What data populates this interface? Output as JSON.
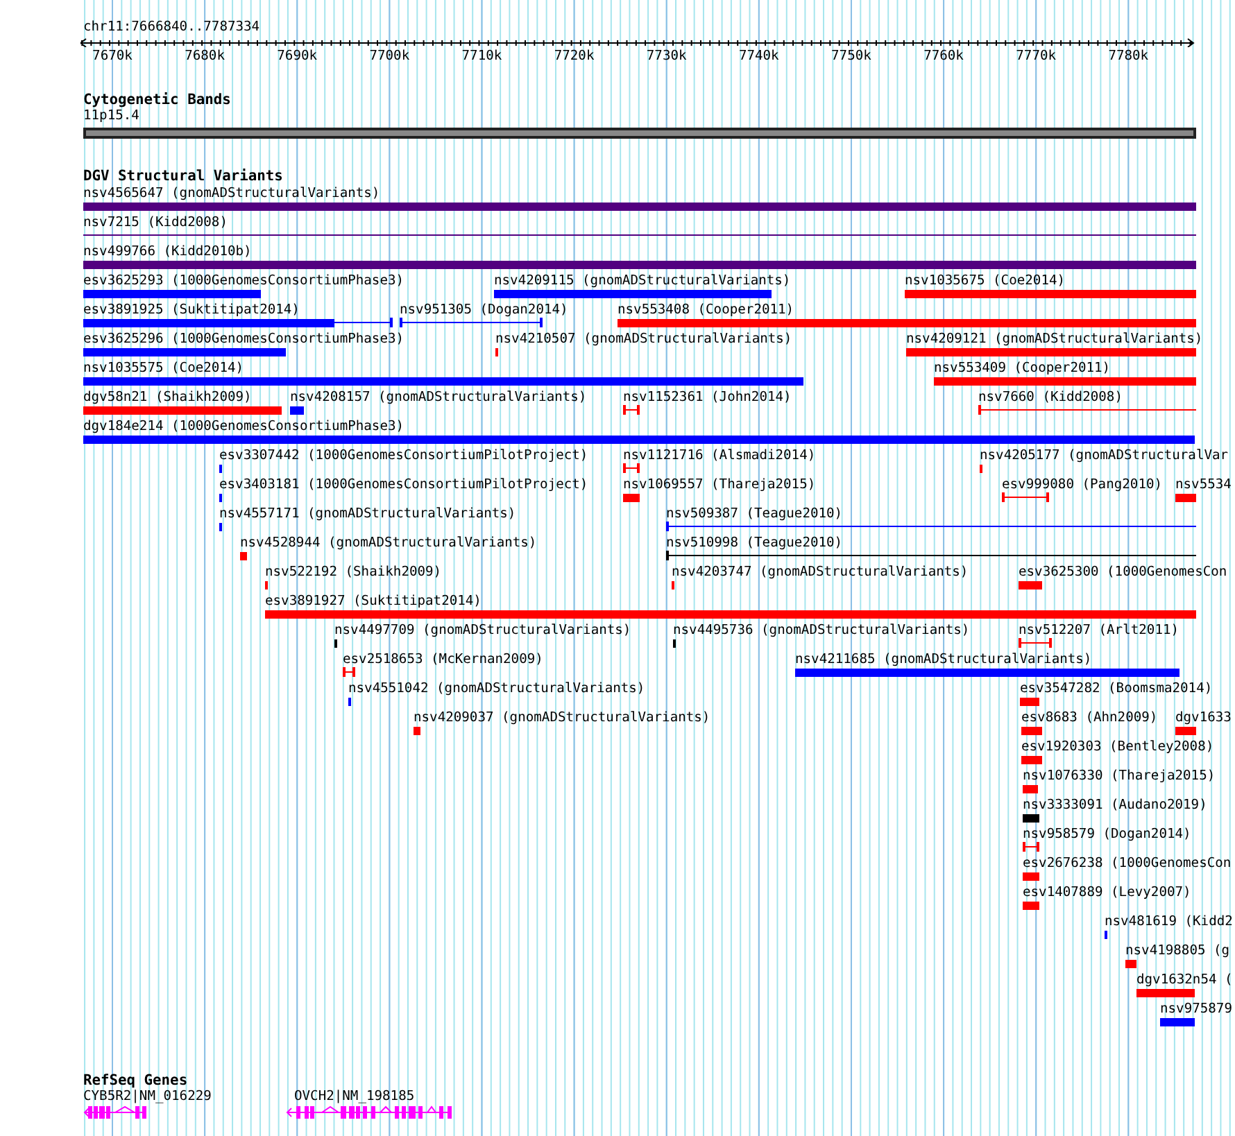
{
  "ruler": {
    "region": "chr11:7666840..7787334",
    "ticks": [
      "7670k",
      "7680k",
      "7690k",
      "7700k",
      "7710k",
      "7720k",
      "7730k",
      "7740k",
      "7750k",
      "7760k",
      "7770k",
      "7780k"
    ]
  },
  "cytogenetic_bands": {
    "title": "Cytogenetic Bands",
    "band": "11p15.4"
  },
  "structural_variants": {
    "title": "DGV Structural Variants",
    "features": [
      {
        "label": "nsv4565647 (gnomADStructuralVariants)",
        "kind": "bar",
        "color": "#520080"
      },
      {
        "label": "nsv7215 (Kidd2008)",
        "kind": "thin",
        "color": "#520080"
      },
      {
        "label": "nsv499766 (Kidd2010b)",
        "kind": "bar",
        "color": "#520080"
      },
      {
        "label": "esv3625293 (1000GenomesConsortiumPhase3)",
        "kind": "bar",
        "color": "#0000ff"
      },
      {
        "label": "nsv4209115 (gnomADStructuralVariants)",
        "kind": "bar",
        "color": "#0000ff"
      },
      {
        "label": "nsv1035675 (Coe2014)",
        "kind": "bar",
        "color": "#ff0000"
      },
      {
        "label": "esv3891925 (Suktitipat2014)",
        "kind": "split",
        "color": "#0000ff"
      },
      {
        "label": "nsv951305 (Dogan2014)",
        "kind": "interval",
        "color": "#0000ff"
      },
      {
        "label": "nsv553408 (Cooper2011)",
        "kind": "bar",
        "color": "#ff0000"
      },
      {
        "label": "esv3625296 (1000GenomesConsortiumPhase3)",
        "kind": "bar",
        "color": "#0000ff"
      },
      {
        "label": "nsv4210507 (gnomADStructuralVariants)",
        "kind": "bar",
        "color": "#ff0000"
      },
      {
        "label": "nsv4209121 (gnomADStructuralVariants)",
        "kind": "bar",
        "color": "#ff0000"
      },
      {
        "label": "nsv1035575 (Coe2014)",
        "kind": "bar",
        "color": "#0000ff"
      },
      {
        "label": "nsv553409 (Cooper2011)",
        "kind": "bar",
        "color": "#ff0000"
      },
      {
        "label": "dgv58n21 (Shaikh2009)",
        "kind": "bar",
        "color": "#ff0000"
      },
      {
        "label": "nsv4208157 (gnomADStructuralVariants)",
        "kind": "bar",
        "color": "#0000ff"
      },
      {
        "label": "nsv1152361 (John2014)",
        "kind": "interval",
        "color": "#ff0000"
      },
      {
        "label": "nsv7660 (Kidd2008)",
        "kind": "ray",
        "color": "#ff0000"
      },
      {
        "label": "dgv184e214 (1000GenomesConsortiumPhase3)",
        "kind": "bar",
        "color": "#0000ff"
      },
      {
        "label": "esv3307442 (1000GenomesConsortiumPilotProject)",
        "kind": "bar",
        "color": "#0000ff"
      },
      {
        "label": "nsv1121716 (Alsmadi2014)",
        "kind": "interval",
        "color": "#ff0000"
      },
      {
        "label": "nsv4205177 (gnomADStructuralVar",
        "kind": "bar",
        "color": "#ff0000"
      },
      {
        "label": "esv3403181 (1000GenomesConsortiumPilotProject)",
        "kind": "bar",
        "color": "#0000ff"
      },
      {
        "label": "nsv1069557 (Thareja2015)",
        "kind": "bar",
        "color": "#ff0000"
      },
      {
        "label": "esv999080 (Pang2010)",
        "kind": "interval",
        "color": "#ff0000"
      },
      {
        "label": "nsv5534",
        "kind": "bar",
        "color": "#ff0000"
      },
      {
        "label": "nsv4557171 (gnomADStructuralVariants)",
        "kind": "bar",
        "color": "#0000ff"
      },
      {
        "label": "nsv509387 (Teague2010)",
        "kind": "ray",
        "color": "#0000ff"
      },
      {
        "label": "nsv4528944 (gnomADStructuralVariants)",
        "kind": "bar",
        "color": "#ff0000"
      },
      {
        "label": "nsv510998 (Teague2010)",
        "kind": "ray",
        "color": "#000000"
      },
      {
        "label": "nsv522192 (Shaikh2009)",
        "kind": "bar",
        "color": "#ff0000"
      },
      {
        "label": "nsv4203747 (gnomADStructuralVariants)",
        "kind": "bar",
        "color": "#ff0000"
      },
      {
        "label": "esv3625300 (1000GenomesCon",
        "kind": "bar",
        "color": "#ff0000"
      },
      {
        "label": "esv3891927 (Suktitipat2014)",
        "kind": "bar",
        "color": "#ff0000"
      },
      {
        "label": "nsv4497709 (gnomADStructuralVariants)",
        "kind": "bar",
        "color": "#000000"
      },
      {
        "label": "nsv4495736 (gnomADStructuralVariants)",
        "kind": "bar",
        "color": "#000000"
      },
      {
        "label": "nsv512207 (Arlt2011)",
        "kind": "interval",
        "color": "#ff0000"
      },
      {
        "label": "esv2518653 (McKernan2009)",
        "kind": "interval",
        "color": "#ff0000"
      },
      {
        "label": "nsv4211685 (gnomADStructuralVariants)",
        "kind": "bar",
        "color": "#0000ff"
      },
      {
        "label": "nsv4551042 (gnomADStructuralVariants)",
        "kind": "bar",
        "color": "#0000ff"
      },
      {
        "label": "esv3547282 (Boomsma2014)",
        "kind": "bar",
        "color": "#ff0000"
      },
      {
        "label": "nsv4209037 (gnomADStructuralVariants)",
        "kind": "bar",
        "color": "#ff0000"
      },
      {
        "label": "esv8683 (Ahn2009)",
        "kind": "bar",
        "color": "#ff0000"
      },
      {
        "label": "dgv1633",
        "kind": "bar",
        "color": "#ff0000"
      },
      {
        "label": "esv1920303 (Bentley2008)",
        "kind": "bar",
        "color": "#ff0000"
      },
      {
        "label": "nsv1076330 (Thareja2015)",
        "kind": "bar",
        "color": "#ff0000"
      },
      {
        "label": "nsv3333091 (Audano2019)",
        "kind": "bar",
        "color": "#000000"
      },
      {
        "label": "nsv958579 (Dogan2014)",
        "kind": "interval",
        "color": "#ff0000"
      },
      {
        "label": "esv2676238 (1000GenomesCon",
        "kind": "bar",
        "color": "#ff0000"
      },
      {
        "label": "esv1407889 (Levy2007)",
        "kind": "bar",
        "color": "#ff0000"
      },
      {
        "label": "nsv481619 (Kidd2",
        "kind": "bar",
        "color": "#0000ff"
      },
      {
        "label": "nsv4198805 (g",
        "kind": "bar",
        "color": "#ff0000"
      },
      {
        "label": "dgv1632n54 (",
        "kind": "bar",
        "color": "#ff0000"
      },
      {
        "label": "nsv975879",
        "kind": "bar",
        "color": "#0000ff"
      }
    ]
  },
  "refseq_genes": {
    "title": "RefSeq Genes",
    "genes": [
      {
        "label": "CYB5R2|NM_016229"
      },
      {
        "label": "OVCH2|NM_198185"
      }
    ]
  }
}
